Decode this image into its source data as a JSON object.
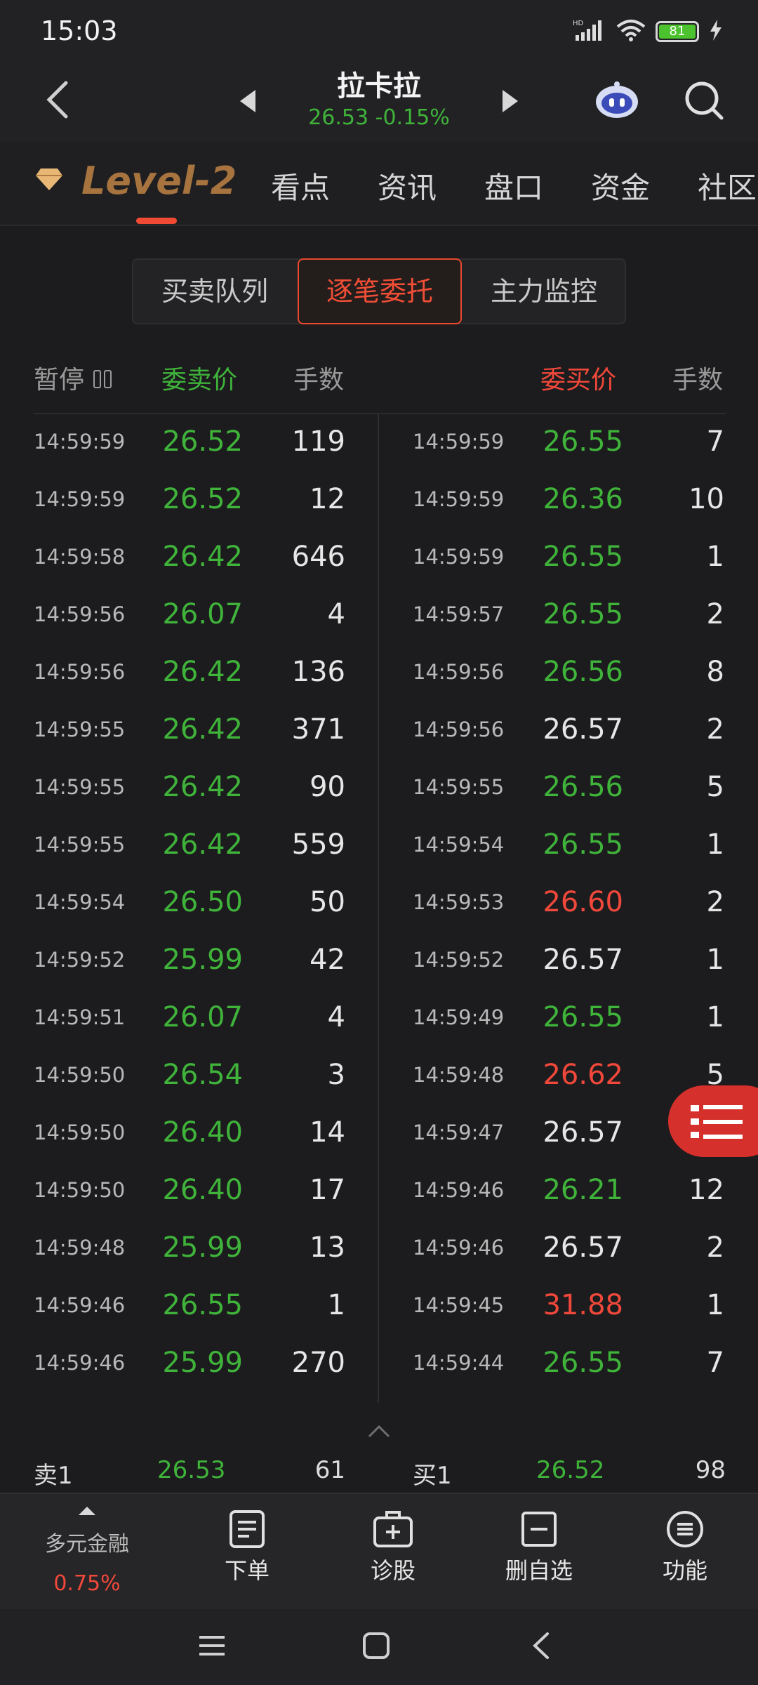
{
  "status": {
    "time": "15:03",
    "battery": "81",
    "network": "HD"
  },
  "header": {
    "title": "拉卡拉",
    "subtitle": "26.53 -0.15%"
  },
  "tabs": [
    "看点",
    "资讯",
    "盘口",
    "资金",
    "社区"
  ],
  "level2_label": "Level-2",
  "segments": [
    "买卖队列",
    "逐笔委托",
    "主力监控"
  ],
  "columns": {
    "pause": "暂停",
    "sell_price": "委卖价",
    "sell_qty": "手数",
    "buy_price": "委买价",
    "buy_qty": "手数"
  },
  "colors": {
    "up": "#f0483a",
    "down": "#3fb33a",
    "flat": "#e6e6e6",
    "accent": "#f24e36"
  },
  "sell_orders": [
    {
      "time": "14:59:59",
      "price": "26.52",
      "qty": "119",
      "color": "green"
    },
    {
      "time": "14:59:59",
      "price": "26.52",
      "qty": "12",
      "color": "green"
    },
    {
      "time": "14:59:58",
      "price": "26.42",
      "qty": "646",
      "color": "green"
    },
    {
      "time": "14:59:56",
      "price": "26.07",
      "qty": "4",
      "color": "green"
    },
    {
      "time": "14:59:56",
      "price": "26.42",
      "qty": "136",
      "color": "green"
    },
    {
      "time": "14:59:55",
      "price": "26.42",
      "qty": "371",
      "color": "green"
    },
    {
      "time": "14:59:55",
      "price": "26.42",
      "qty": "90",
      "color": "green"
    },
    {
      "time": "14:59:55",
      "price": "26.42",
      "qty": "559",
      "color": "green"
    },
    {
      "time": "14:59:54",
      "price": "26.50",
      "qty": "50",
      "color": "green"
    },
    {
      "time": "14:59:52",
      "price": "25.99",
      "qty": "42",
      "color": "green"
    },
    {
      "time": "14:59:51",
      "price": "26.07",
      "qty": "4",
      "color": "green"
    },
    {
      "time": "14:59:50",
      "price": "26.54",
      "qty": "3",
      "color": "green"
    },
    {
      "time": "14:59:50",
      "price": "26.40",
      "qty": "14",
      "color": "green"
    },
    {
      "time": "14:59:50",
      "price": "26.40",
      "qty": "17",
      "color": "green"
    },
    {
      "time": "14:59:48",
      "price": "25.99",
      "qty": "13",
      "color": "green"
    },
    {
      "time": "14:59:46",
      "price": "26.55",
      "qty": "1",
      "color": "green"
    },
    {
      "time": "14:59:46",
      "price": "25.99",
      "qty": "270",
      "color": "green"
    }
  ],
  "buy_orders": [
    {
      "time": "14:59:59",
      "price": "26.55",
      "qty": "7",
      "color": "green"
    },
    {
      "time": "14:59:59",
      "price": "26.36",
      "qty": "10",
      "color": "green"
    },
    {
      "time": "14:59:59",
      "price": "26.55",
      "qty": "1",
      "color": "green"
    },
    {
      "time": "14:59:57",
      "price": "26.55",
      "qty": "2",
      "color": "green"
    },
    {
      "time": "14:59:56",
      "price": "26.56",
      "qty": "8",
      "color": "green"
    },
    {
      "time": "14:59:56",
      "price": "26.57",
      "qty": "2",
      "color": "white"
    },
    {
      "time": "14:59:55",
      "price": "26.56",
      "qty": "5",
      "color": "green"
    },
    {
      "time": "14:59:54",
      "price": "26.55",
      "qty": "1",
      "color": "green"
    },
    {
      "time": "14:59:53",
      "price": "26.60",
      "qty": "2",
      "color": "red"
    },
    {
      "time": "14:59:52",
      "price": "26.57",
      "qty": "1",
      "color": "white"
    },
    {
      "time": "14:59:49",
      "price": "26.55",
      "qty": "1",
      "color": "green"
    },
    {
      "time": "14:59:48",
      "price": "26.62",
      "qty": "5",
      "color": "red"
    },
    {
      "time": "14:59:47",
      "price": "26.57",
      "qty": "7",
      "color": "white"
    },
    {
      "time": "14:59:46",
      "price": "26.21",
      "qty": "12",
      "color": "green"
    },
    {
      "time": "14:59:46",
      "price": "26.57",
      "qty": "2",
      "color": "white"
    },
    {
      "time": "14:59:45",
      "price": "31.88",
      "qty": "1",
      "color": "red"
    },
    {
      "time": "14:59:44",
      "price": "26.55",
      "qty": "7",
      "color": "green"
    }
  ],
  "summary": {
    "sell_label": "卖1",
    "sell_price": "26.53",
    "sell_qty": "61",
    "buy_label": "买1",
    "buy_price": "26.52",
    "buy_qty": "98"
  },
  "bottom": {
    "fund_name": "多元金融",
    "fund_pct": "0.75%",
    "items": [
      "下单",
      "诊股",
      "删自选",
      "功能"
    ]
  }
}
